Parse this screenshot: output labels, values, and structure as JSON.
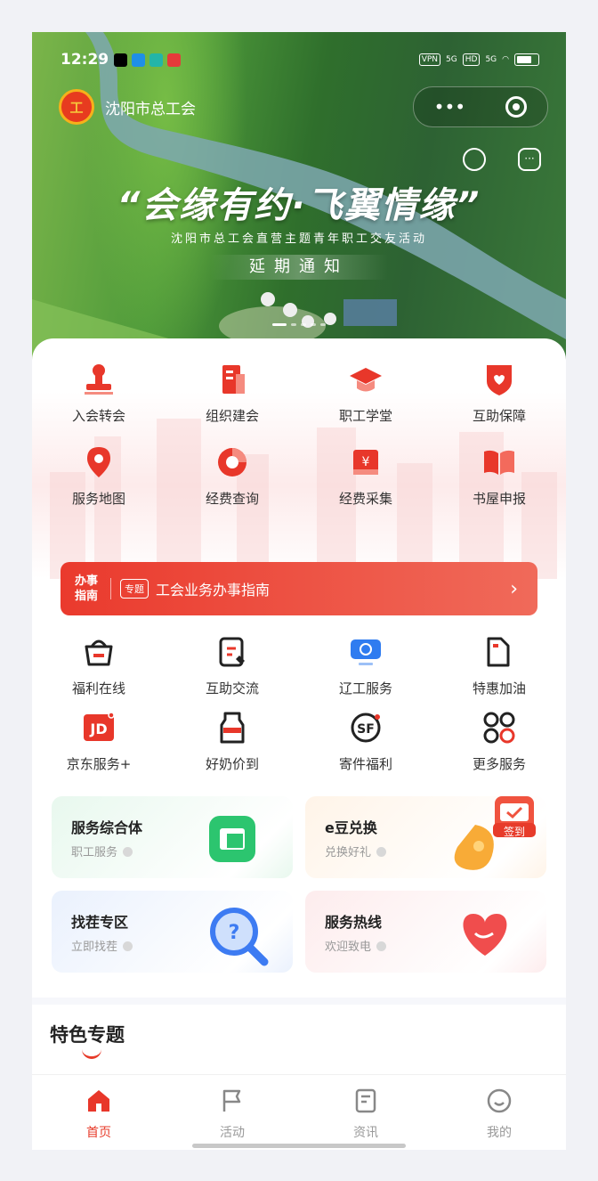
{
  "status_bar": {
    "time": "12:29",
    "right": [
      "VPN",
      "5G",
      "HD",
      "5G"
    ]
  },
  "app": {
    "name": "沈阳市总工会",
    "logo_text": "工",
    "menu_dots": "•••"
  },
  "hero": {
    "slogan": "“会缘有约·飞翼情缘”",
    "subtitle": "沈阳市总工会直营主题青年职工交友活动",
    "notice": "延期通知"
  },
  "grid1": [
    {
      "label": "入会转会",
      "icon": "stamp-icon"
    },
    {
      "label": "组织建会",
      "icon": "building-icon"
    },
    {
      "label": "职工学堂",
      "icon": "graduation-cap-icon"
    },
    {
      "label": "互助保障",
      "icon": "shield-icon"
    },
    {
      "label": "服务地图",
      "icon": "map-pin-icon"
    },
    {
      "label": "经费查询",
      "icon": "donut-chart-icon"
    },
    {
      "label": "经费采集",
      "icon": "money-box-icon"
    },
    {
      "label": "书屋申报",
      "icon": "book-icon"
    }
  ],
  "banner": {
    "title": "办事指南",
    "tag": "专题",
    "text": "工会业务办事指南",
    "chevron": "›"
  },
  "grid2": [
    {
      "label": "福利在线",
      "icon": "gift-basket-icon"
    },
    {
      "label": "互助交流",
      "icon": "edit-note-icon"
    },
    {
      "label": "辽工服务",
      "icon": "monitor-icon"
    },
    {
      "label": "特惠加油",
      "icon": "fuel-icon"
    },
    {
      "label": "京东服务+",
      "icon": "jd-icon",
      "glyph": "JD"
    },
    {
      "label": "好奶价到",
      "icon": "milk-icon"
    },
    {
      "label": "寄件福利",
      "icon": "sf-express-icon",
      "glyph": "SF"
    },
    {
      "label": "更多服务",
      "icon": "more-grid-icon"
    }
  ],
  "tiles": [
    {
      "title": "服务综合体",
      "sub": "职工服务",
      "color": "#e8f8ee",
      "accent": "#2cc56f"
    },
    {
      "title": "e豆兑换",
      "sub": "兑换好礼",
      "color": "#fff4e8",
      "accent": "#f7a221"
    },
    {
      "title": "找茬专区",
      "sub": "立即找茬",
      "color": "#eaf1fd",
      "accent": "#3d7bf2"
    },
    {
      "title": "服务热线",
      "sub": "欢迎致电",
      "color": "#fdeced",
      "accent": "#f04d4d"
    }
  ],
  "signin": {
    "label": "签到"
  },
  "special": {
    "title": "特色专题"
  },
  "tabs": [
    {
      "label": "首页",
      "icon": "home-icon",
      "active": true
    },
    {
      "label": "活动",
      "icon": "flag-icon",
      "active": false
    },
    {
      "label": "资讯",
      "icon": "news-icon",
      "active": false
    },
    {
      "label": "我的",
      "icon": "smile-icon",
      "active": false
    }
  ],
  "colors": {
    "primary": "#e73b2a",
    "hero_green": "#3b7a3a"
  }
}
